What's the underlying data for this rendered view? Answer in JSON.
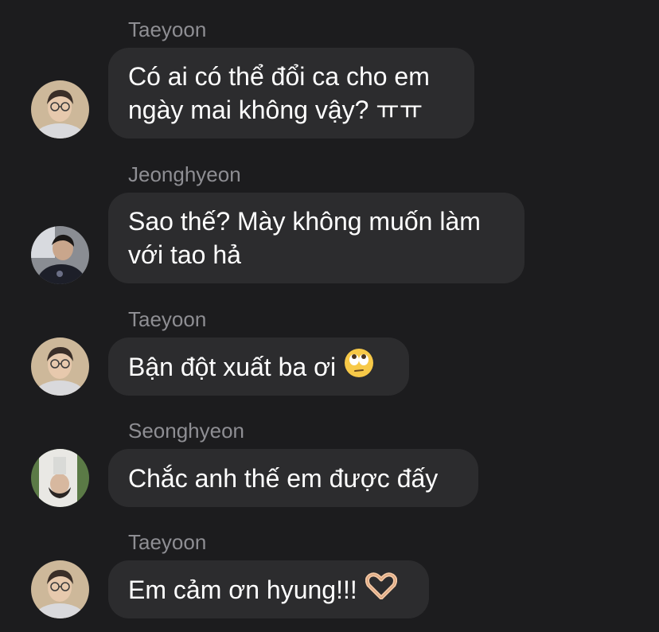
{
  "messages": [
    {
      "sender": "Taeyoon",
      "text": "Có ai có thể đổi ca cho em ngày mai không vậy? ㅠㅠ",
      "avatar": "taeyoon-avatar"
    },
    {
      "sender": "Jeonghyeon",
      "text": "Sao thế? Mày không muốn làm với tao hả",
      "avatar": "jeonghyeon-avatar"
    },
    {
      "sender": "Taeyoon",
      "text": "Bận đột xuất ba ơi",
      "avatar": "taeyoon-avatar",
      "emoji": "eye-roll-emoji"
    },
    {
      "sender": "Seonghyeon",
      "text": "Chắc anh thế em được đấy",
      "avatar": "seonghyeon-avatar"
    },
    {
      "sender": "Taeyoon",
      "text": "Em cảm ơn hyung!!!",
      "avatar": "taeyoon-avatar",
      "emoji": "heart-hands-emoji"
    }
  ],
  "colors": {
    "background": "#1c1c1e",
    "bubble": "#2c2c2e",
    "sender_text": "#8e8e93",
    "message_text": "#ffffff"
  }
}
